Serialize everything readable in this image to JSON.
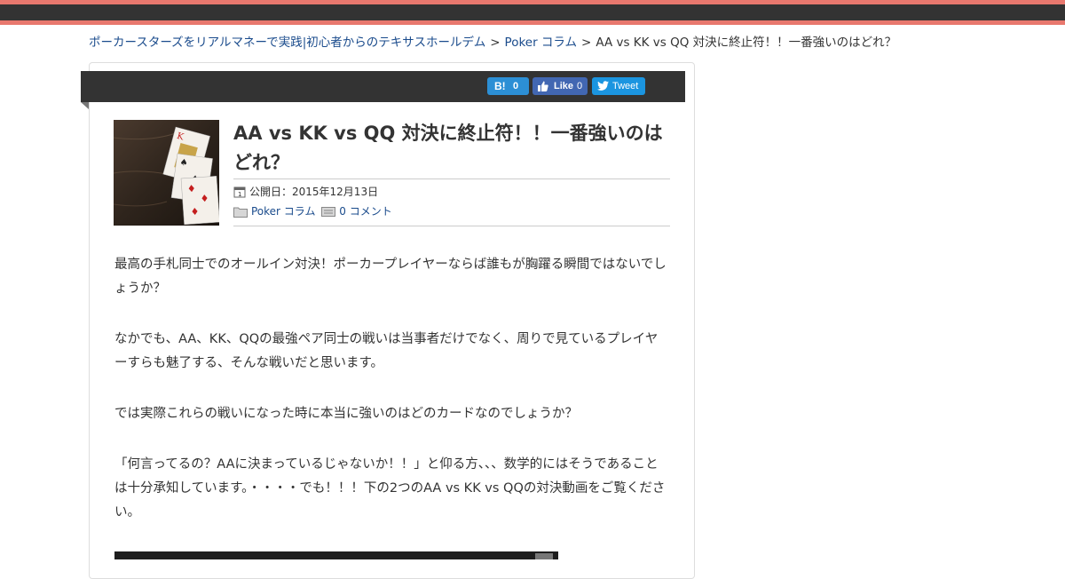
{
  "breadcrumb": {
    "home": "ポーカースターズをリアルマネーで実践|初心者からのテキサスホールデム",
    "category": "Poker コラム",
    "current": "AA vs KK vs QQ 対決に終止符！！一番強いのはどれ？",
    "separator": ">"
  },
  "social": {
    "hatena_label": "B!",
    "hatena_count": "0",
    "facebook_label": "Like",
    "facebook_count": "0",
    "twitter_label": "Tweet"
  },
  "post": {
    "title": "AA vs KK vs QQ 対決に終止符！！一番強いのはどれ？",
    "published_label": "公開日：2015年12月13日",
    "category": "Poker コラム",
    "comments": "0 コメント"
  },
  "paragraphs": [
    "最高の手札同士でのオールイン対決！ポーカープレイヤーならば誰もが胸躍る瞬間ではないでしょうか？",
    "なかでも、AA、KK、QQの最強ペア同士の戦いは当事者だけでなく、周りで見ているプレイヤーすらも魅了する、そんな戦いだと思います。",
    "では実際これらの戦いになった時に本当に強いのはどのカードなのでしょうか？",
    "「何言ってるの？AAに決まっているじゃないか！！」と仰る方、、、数学的にはそうであることは十分承知しています。・・・・でも！！！下の2つのAA vs KK vs QQの対決動画をご覧ください。"
  ],
  "colors": {
    "accent": "#e8786e",
    "dark": "#333333",
    "link": "#1a4b8c",
    "hatena": "#2c8fd5",
    "facebook": "#4267b2",
    "twitter": "#1b95e0"
  }
}
